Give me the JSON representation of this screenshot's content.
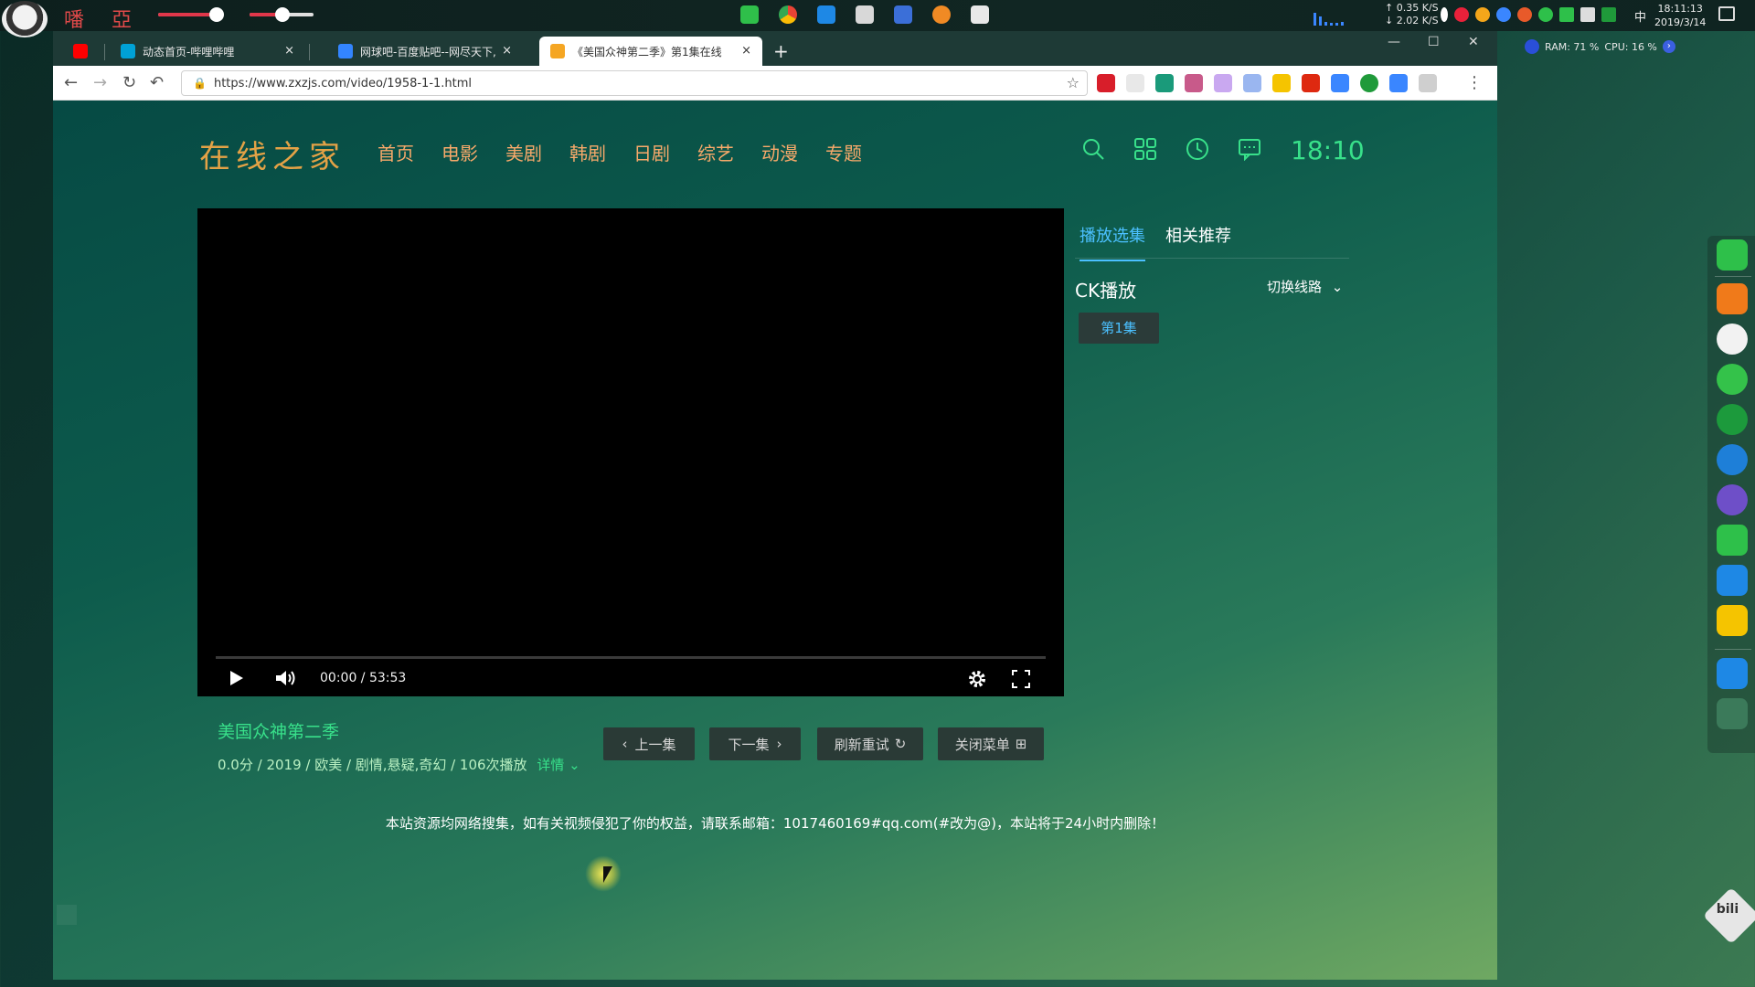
{
  "desktop": {
    "glyph1": "噃",
    "glyph2": "亞",
    "net_up": "0.35 K/S",
    "net_down": "2.02 K/S",
    "ime": "中",
    "time": "18:11:13",
    "date": "2019/3/14",
    "ram_label": "RAM: 71 %",
    "cpu_label": "CPU: 16 %",
    "bili_label": "bili"
  },
  "browser": {
    "tabs": [
      {
        "label": ""
      },
      {
        "label": "动态首页-哔哩哔哩"
      },
      {
        "label": "网球吧-百度贴吧--网尽天下,"
      },
      {
        "label": "《美国众神第二季》第1集在线"
      }
    ],
    "tab_close": "×",
    "new_tab": "+",
    "url": "https://www.zxzjs.com/video/1958-1-1.html"
  },
  "site": {
    "logo": "在线之家",
    "nav": [
      "首页",
      "电影",
      "美剧",
      "韩剧",
      "日剧",
      "综艺",
      "动漫",
      "专题"
    ],
    "header_time": "18:10",
    "player": {
      "timecode": "00:00 / 53:53",
      "progress": 0
    },
    "side_tabs": [
      "播放选集",
      "相关推荐"
    ],
    "source_name": "CK播放",
    "switch_line": "切换线路",
    "episode": "第1集",
    "video": {
      "title": "美国众神第二季",
      "meta": "0.0分 / 2019 / 欧美 / 剧情,悬疑,奇幻 / 106次播放",
      "detail": "详情"
    },
    "buttons": {
      "prev": "上一集",
      "next": "下一集",
      "refresh": "刷新重试",
      "close_menu": "关闭菜单"
    },
    "notice": "本站资源均网络搜集，如有关视频侵犯了你的权益，请联系邮箱：1017460169#qq.com(#改为@)，本站将于24小时内删除！"
  },
  "colors": {
    "accent_green": "#38e08a",
    "accent_blue": "#4bc0ff",
    "nav_orange": "#f7a96a",
    "logo_gold": "#e3a246"
  }
}
